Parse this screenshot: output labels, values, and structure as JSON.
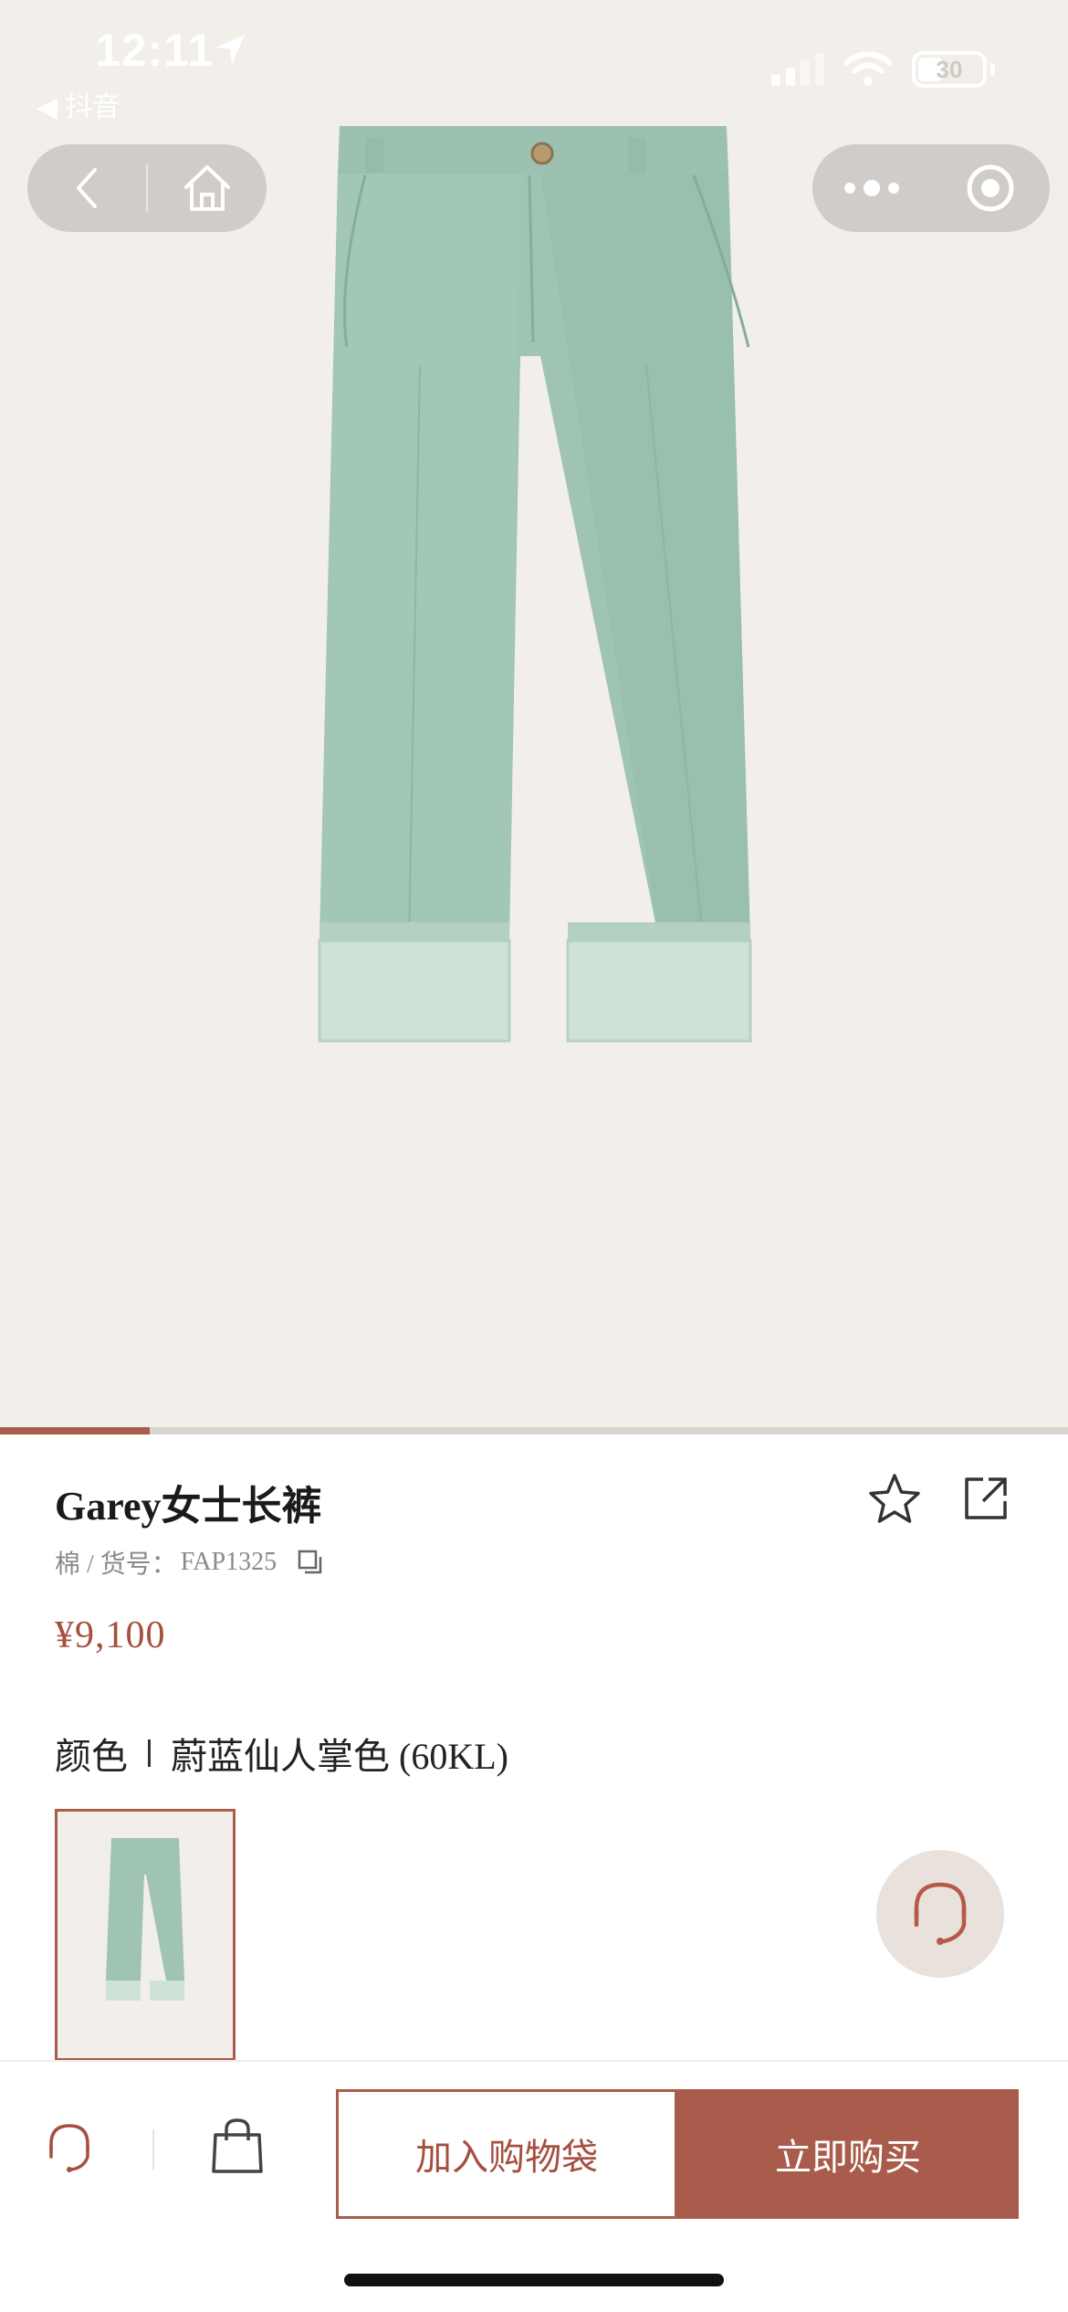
{
  "status_bar": {
    "time": "12:11",
    "back_app": "◀ 抖音",
    "battery": "30"
  },
  "icons": {
    "back": "chevron-left-icon",
    "home": "home-icon",
    "more": "more-dots-icon",
    "close_miniapp": "target-circle-icon",
    "favorite": "star-icon",
    "share": "share-external-icon",
    "copy": "copy-icon",
    "customer_service": "headset-icon",
    "bag": "shopping-bag-icon"
  },
  "gallery": {
    "progress": 0.14
  },
  "product": {
    "title": "Garey女士长裤",
    "material": "棉 / 货号：",
    "sku": "FAP1325",
    "price": "¥9,100",
    "color_label": "颜色",
    "color_value": "蔚蓝仙人掌色 (60KL)"
  },
  "actions": {
    "add_to_bag": "加入购物袋",
    "buy_now": "立即购买"
  },
  "colors": {
    "accent": "#a95c4b",
    "price": "#a54f3f",
    "hero_bg": "#f2efea",
    "pants": "#9fc4b3"
  }
}
